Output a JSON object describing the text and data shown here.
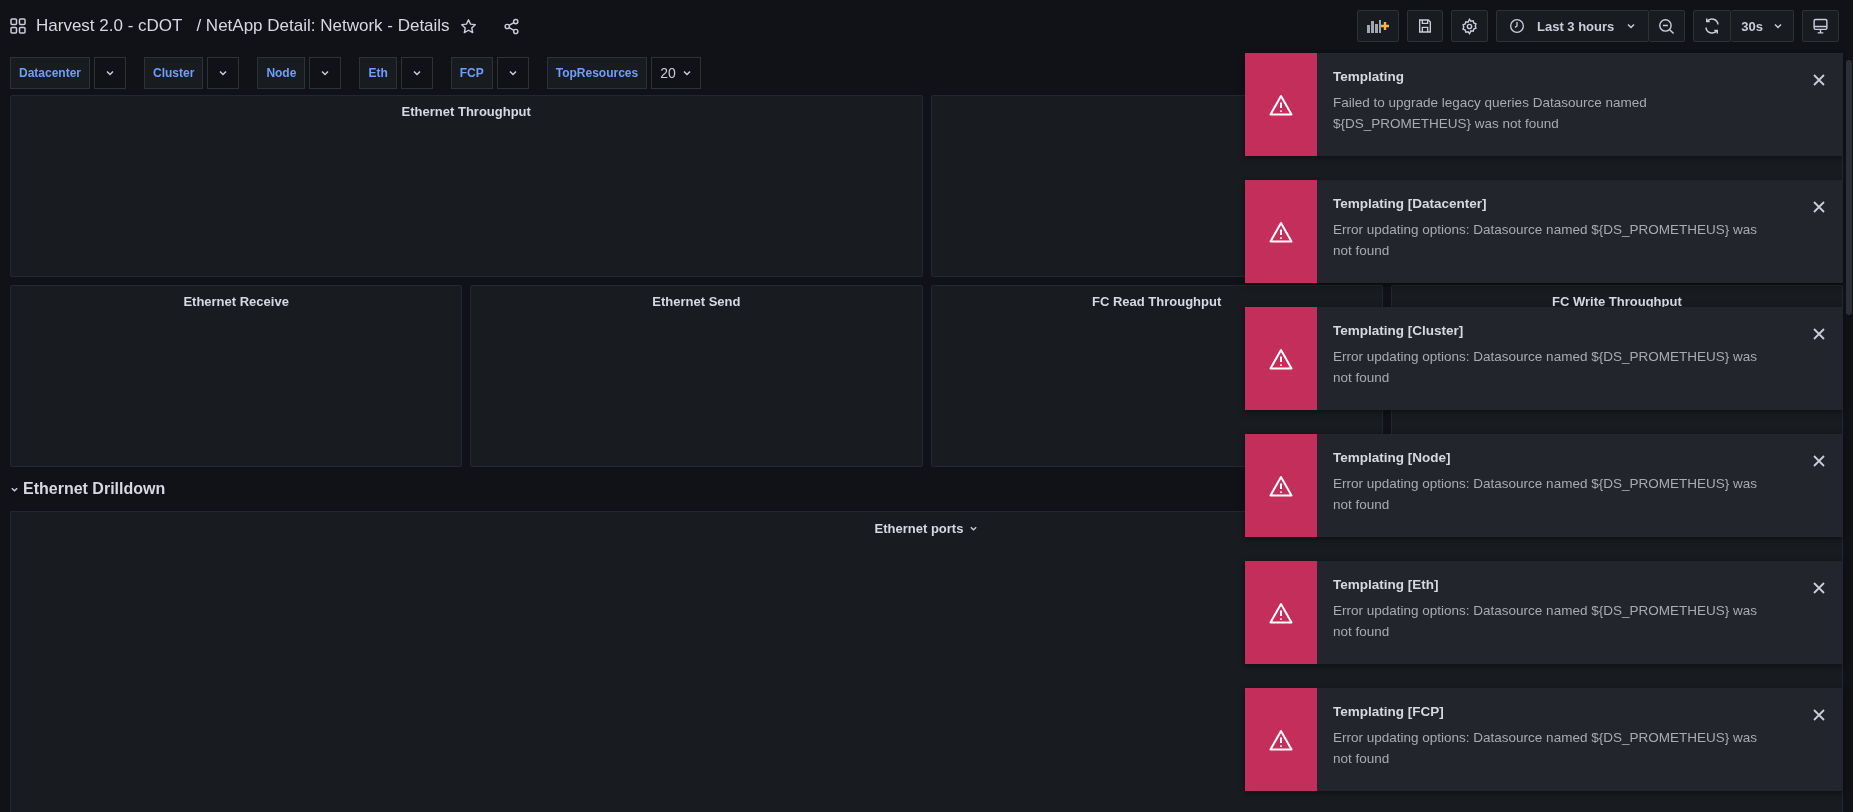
{
  "header": {
    "folder": "Harvest 2.0 - cDOT",
    "title": "/ NetApp Detail: Network - Details"
  },
  "toolbar": {
    "time_range": "Last 3 hours",
    "refresh_interval": "30s"
  },
  "variables": [
    {
      "label": "Datacenter"
    },
    {
      "label": "Cluster"
    },
    {
      "label": "Node"
    },
    {
      "label": "Eth"
    },
    {
      "label": "FCP"
    },
    {
      "label": "TopResources",
      "value": "20"
    }
  ],
  "rows": [
    {
      "panels": [
        {
          "kind": "titled",
          "title": "Ethernet Throughput"
        },
        {
          "kind": "untitled"
        }
      ]
    },
    {
      "panels": [
        {
          "kind": "titled",
          "title": "Ethernet Receive"
        },
        {
          "kind": "titled",
          "title": "Ethernet Send"
        },
        {
          "kind": "titled",
          "title": "FC Read Throughput"
        },
        {
          "kind": "titled",
          "title": "FC Write Throughput"
        }
      ]
    }
  ],
  "section": {
    "title": "Ethernet Drilldown",
    "expanded": true,
    "panel": {
      "title": "Ethernet ports"
    }
  },
  "toasts": [
    {
      "title": "Templating",
      "text": "Failed to upgrade legacy queries Datasource named ${DS_PROMETHEUS} was not found"
    },
    {
      "title": "Templating [Datacenter]",
      "text": "Error updating options: Datasource named ${DS_PROMETHEUS} was not found"
    },
    {
      "title": "Templating [Cluster]",
      "text": "Error updating options: Datasource named ${DS_PROMETHEUS} was not found"
    },
    {
      "title": "Templating [Node]",
      "text": "Error updating options: Datasource named ${DS_PROMETHEUS} was not found"
    },
    {
      "title": "Templating [Eth]",
      "text": "Error updating options: Datasource named ${DS_PROMETHEUS} was not found"
    },
    {
      "title": "Templating [FCP]",
      "text": "Error updating options: Datasource named ${DS_PROMETHEUS} was not found"
    }
  ]
}
